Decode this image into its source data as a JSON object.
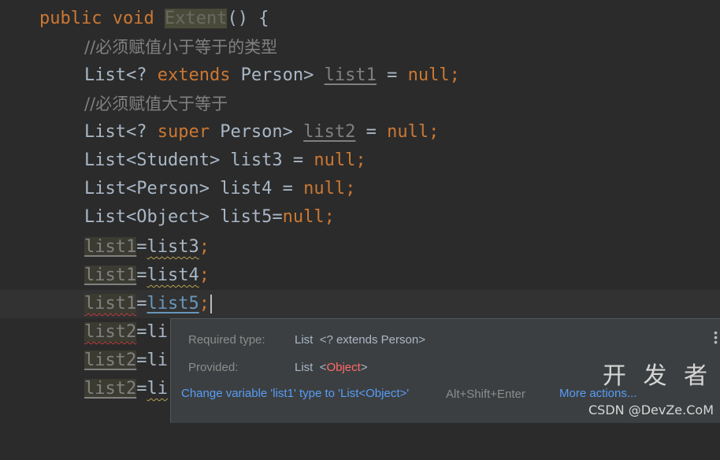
{
  "editor": {
    "method_signature": {
      "public": "public",
      "void": "void",
      "name": "Extent",
      "rest": "() {"
    },
    "comment1": "//必须赋值小于等于的类型",
    "line_list1": {
      "a": "List<? ",
      "kw": "extends",
      "b": " Person> ",
      "var": "list1",
      "c": " = ",
      "null": "null",
      "d": ";"
    },
    "comment2": "//必须赋值大于等于",
    "line_list2": {
      "a": "List<? ",
      "kw": "super",
      "b": " Person> ",
      "var": "list2",
      "c": " = ",
      "null": "null",
      "d": ";"
    },
    "line_list3": {
      "a": "List<Student> list3 = ",
      "null": "null",
      "d": ";"
    },
    "line_list4": {
      "a": "List<Person> list4 = ",
      "null": "null",
      "d": ";"
    },
    "line_list5": {
      "a": "List<Object> list5=",
      "null": "null",
      "d": ";"
    },
    "assign1": {
      "lhs": "list1",
      "eq": "=",
      "rhs": "list3",
      "semi": ";"
    },
    "assign2": {
      "lhs": "list1",
      "eq": "=",
      "rhs": "list4",
      "semi": ";"
    },
    "assign3": {
      "lhs": "list1",
      "eq": "=",
      "rhs": "list5",
      "semi": ";"
    },
    "assign4": {
      "lhs": "list2",
      "eq": "=",
      "rhs": "li"
    },
    "assign5": {
      "lhs": "list2",
      "eq": "=",
      "rhs": "li"
    },
    "assign6": {
      "lhs": "list2",
      "eq": "=",
      "rhs": "li"
    }
  },
  "popup": {
    "required_label": "Required type:",
    "required_value_a": "List",
    "required_value_b": "<? extends Person>",
    "provided_label": "Provided:",
    "provided_value_a": "List",
    "provided_value_lt": "<",
    "provided_value_obj": "Object",
    "provided_value_gt": ">",
    "fix_action": "Change variable 'list1' type to 'List<Object>'",
    "fix_shortcut": "Alt+Shift+Enter",
    "more_actions": "More actions..."
  },
  "watermark": {
    "big": "开 发 者",
    "small": "CSDN @DevZe.CoM"
  },
  "colors": {
    "keyword": "#cc7832",
    "error": "#bc3f3c",
    "link": "#589df6",
    "background": "#2b2b2b"
  }
}
